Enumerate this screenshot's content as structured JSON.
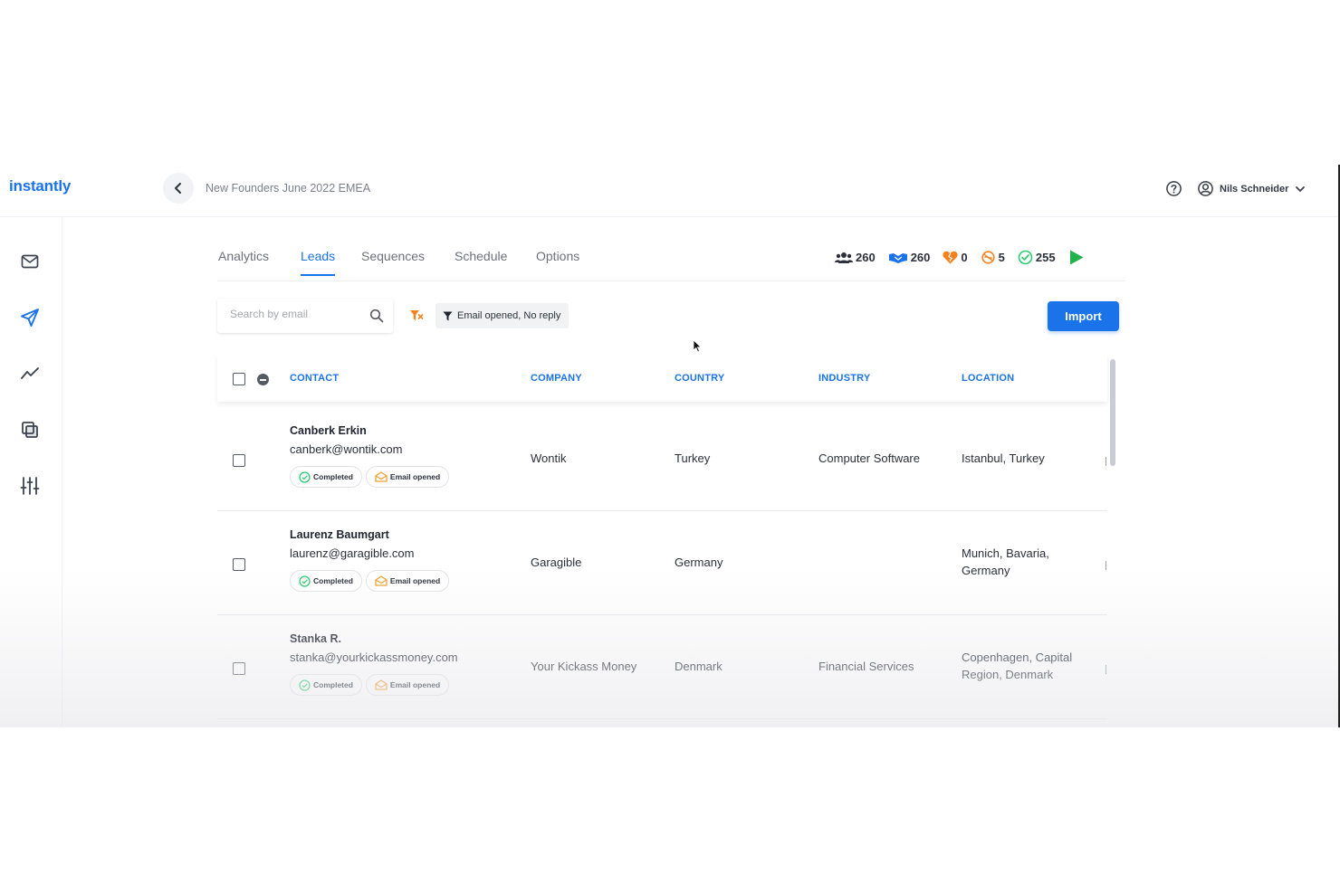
{
  "app": {
    "logo": "instantly",
    "campaign_title": "New Founders June 2022 EMEA"
  },
  "user": {
    "name": "Nils Schneider"
  },
  "icons": {
    "back": "chevron-left-icon",
    "help": "help-circle-icon",
    "user": "user-circle-icon",
    "dropdown": "chevron-down-icon",
    "sidebar": [
      "mail-icon",
      "send-icon",
      "analytics-icon",
      "copy-icon",
      "settings-sliders-icon"
    ]
  },
  "tabs": [
    {
      "label": "Analytics"
    },
    {
      "label": "Leads"
    },
    {
      "label": "Sequences"
    },
    {
      "label": "Schedule"
    },
    {
      "label": "Options"
    }
  ],
  "active_tab": "Leads",
  "stats": {
    "total_leads": "260",
    "contacted": "260",
    "bounced": "0",
    "unsubscribed": "5",
    "completed": "255"
  },
  "colors": {
    "accent": "#1a73e8",
    "play": "#22b14c",
    "bounce": "#f5821f",
    "completed": "#2ecc71",
    "opened": "#f0a030"
  },
  "toolbar": {
    "search_placeholder": "Search by email",
    "filter_label": "Email opened, No reply",
    "import_label": "Import"
  },
  "table": {
    "columns": [
      "CONTACT",
      "COMPANY",
      "COUNTRY",
      "INDUSTRY",
      "LOCATION"
    ],
    "badge_labels": {
      "completed": "Completed",
      "opened": "Email opened"
    },
    "rows": [
      {
        "name": "Canberk Erkin",
        "email": "canberk@wontik.com",
        "company": "Wontik",
        "country": "Turkey",
        "industry": "Computer Software",
        "location_line1": "Istanbul, Turkey",
        "location_line2": ""
      },
      {
        "name": "Laurenz Baumgart",
        "email": "laurenz@garagible.com",
        "company": "Garagible",
        "country": "Germany",
        "industry": "",
        "location_line1": "Munich, Bavaria,",
        "location_line2": "Germany"
      },
      {
        "name": "Stanka R.",
        "email": "stanka@yourkickassmoney.com",
        "company": "Your Kickass Money",
        "country": "Denmark",
        "industry": "Financial Services",
        "location_line1": "Copenhagen, Capital",
        "location_line2": "Region, Denmark"
      }
    ]
  }
}
